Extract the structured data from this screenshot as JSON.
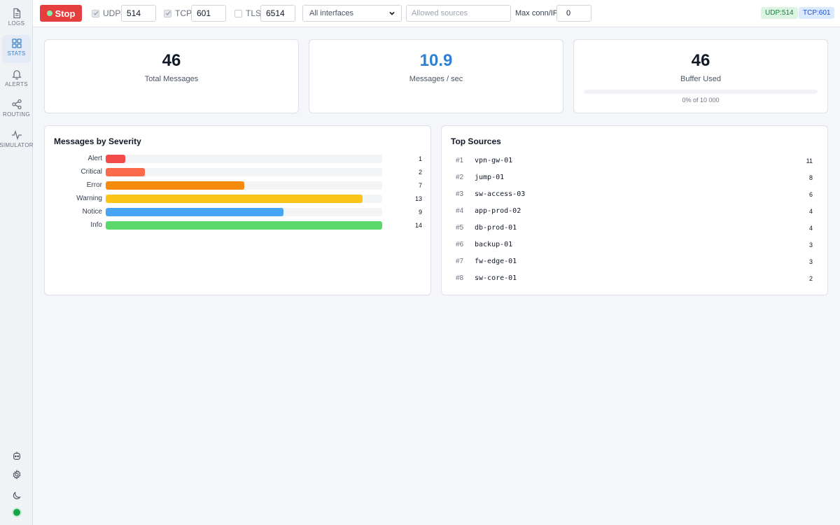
{
  "sidebar": {
    "items": [
      {
        "label": "LOGS",
        "icon": "file-icon"
      },
      {
        "label": "STATS",
        "icon": "grid-icon",
        "active": true
      },
      {
        "label": "ALERTS",
        "icon": "bell-icon"
      },
      {
        "label": "ROUTING",
        "icon": "share-icon"
      },
      {
        "label": "SIMULATOR",
        "icon": "pulse-icon"
      }
    ],
    "bottom_icons": [
      "robot-icon",
      "gear-icon",
      "moon-icon"
    ],
    "status_color": "#16a34a"
  },
  "toolbar": {
    "stop_label": "Stop",
    "udp": {
      "label": "UDP",
      "checked": true,
      "port": "514"
    },
    "tcp": {
      "label": "TCP",
      "checked": true,
      "port": "601"
    },
    "tls": {
      "label": "TLS",
      "checked": false,
      "port": "6514"
    },
    "interface_select": "All interfaces",
    "sources_placeholder": "Allowed sources",
    "maxconn_label": "Max conn/IP",
    "maxconn_value": "0",
    "badges": {
      "udp": "UDP:514",
      "tcp": "TCP:601"
    }
  },
  "stats": {
    "total": {
      "value": "46",
      "label": "Total Messages"
    },
    "rate": {
      "value": "10.9",
      "label": "Messages / sec"
    },
    "buffer": {
      "value": "46",
      "label": "Buffer Used",
      "sub": "0% of 10 000",
      "fill_percent": 0
    }
  },
  "severity": {
    "title": "Messages by Severity",
    "max": 14,
    "rows": [
      {
        "name": "Alert",
        "count": 1,
        "color": "#f44a4a"
      },
      {
        "name": "Critical",
        "count": 2,
        "color": "#fb6a4a"
      },
      {
        "name": "Error",
        "count": 7,
        "color": "#f58a0b"
      },
      {
        "name": "Warning",
        "count": 13,
        "color": "#fcc419"
      },
      {
        "name": "Notice",
        "count": 9,
        "color": "#48a5f5"
      },
      {
        "name": "Info",
        "count": 14,
        "color": "#5ad86a"
      }
    ]
  },
  "sources": {
    "title": "Top Sources",
    "rows": [
      {
        "rank": "#1",
        "name": "vpn-gw-01",
        "count": "11"
      },
      {
        "rank": "#2",
        "name": "jump-01",
        "count": "8"
      },
      {
        "rank": "#3",
        "name": "sw-access-03",
        "count": "6"
      },
      {
        "rank": "#4",
        "name": "app-prod-02",
        "count": "4"
      },
      {
        "rank": "#5",
        "name": "db-prod-01",
        "count": "4"
      },
      {
        "rank": "#6",
        "name": "backup-01",
        "count": "3"
      },
      {
        "rank": "#7",
        "name": "fw-edge-01",
        "count": "3"
      },
      {
        "rank": "#8",
        "name": "sw-core-01",
        "count": "2"
      }
    ]
  }
}
